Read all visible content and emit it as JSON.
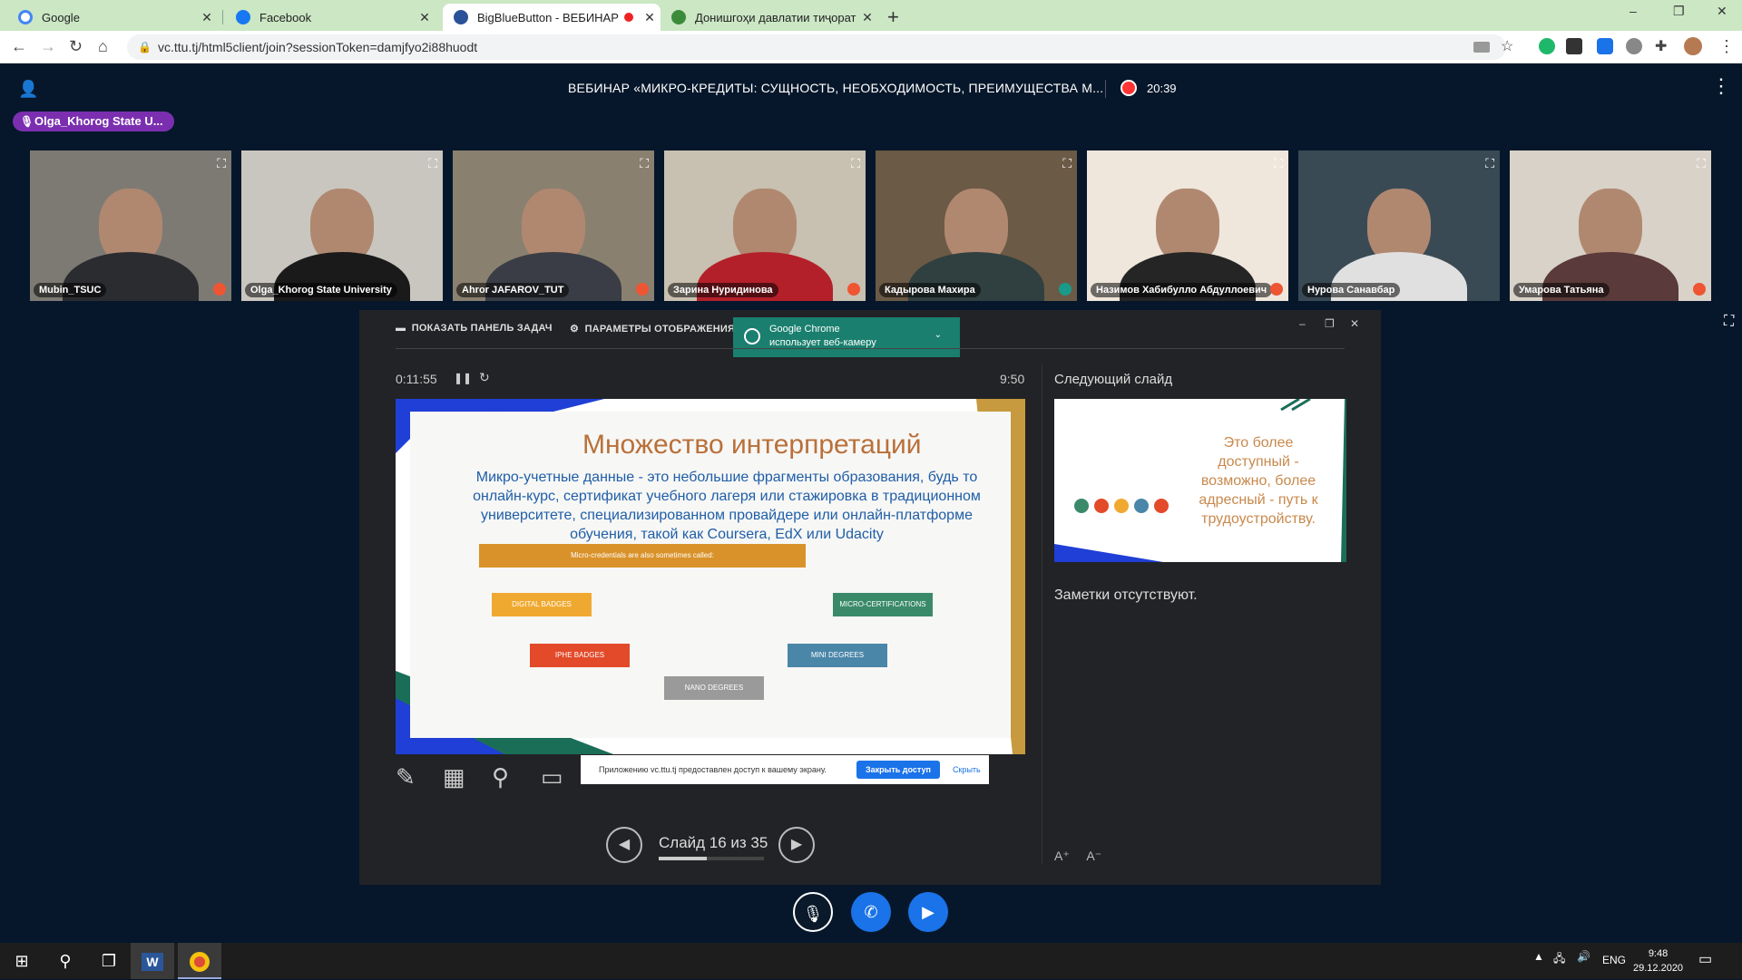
{
  "browser": {
    "tabs": [
      {
        "title": "Google",
        "favicon_color": "#4285f4"
      },
      {
        "title": "Facebook",
        "favicon_color": "#1877f2"
      },
      {
        "title": "BigBlueButton - ВЕБИНАР",
        "favicon_color": "#2a5298"
      },
      {
        "title": "Донишгоҳи давлатии тиҷорати",
        "favicon_color": "#3b8b3b"
      }
    ],
    "url": "vc.ttu.tj/html5client/join?sessionToken=damjfyo2i88huodt",
    "new_tab": "+",
    "window_controls": [
      "–",
      "❐",
      "✕"
    ]
  },
  "meeting": {
    "title": "ВЕБИНАР «МИКРО-КРЕДИТЫ: СУЩНОСТЬ, НЕОБХОДИМОСТЬ, ПРЕИМУЩЕСТВА М...",
    "record_time": "20:39",
    "talking_user": "Olga_Khorog State U..."
  },
  "videos": [
    {
      "name": "Mubin_TSUC",
      "bg": "#7d7a74",
      "shirt": "#2a2c30"
    },
    {
      "name": "Olga_Khorog State University",
      "bg": "#c9c6bf",
      "shirt": "#1a1a1a"
    },
    {
      "name": "Ahror JAFAROV_TUT",
      "bg": "#8a8070",
      "shirt": "#3a3d45"
    },
    {
      "name": "Зарина Нуридинова",
      "bg": "#c8c0b0",
      "shirt": "#b4202a"
    },
    {
      "name": "Кадырова Махира",
      "bg": "#6b5a45",
      "shirt": "#304040"
    },
    {
      "name": "Назимов Хабибулло Абдуллоевич",
      "bg": "#efe6dc",
      "shirt": "#252525"
    },
    {
      "name": "Нурова Санавбар",
      "bg": "#3a4a55",
      "shirt": "#e0e0e0"
    },
    {
      "name": "Умарова Татьяна",
      "bg": "#d9d2c8",
      "shirt": "#5a3a3a"
    }
  ],
  "presenter": {
    "show_taskbar": "ПОКАЗАТЬ ПАНЕЛЬ ЗАДАЧ",
    "display_settings": "ПАРАМЕТРЫ ОТОБРАЖЕНИЯ ▾",
    "notification_title": "Google Chrome",
    "notification_text": "использует веб-камеру",
    "elapsed": "0:11:55",
    "clock": "9:50",
    "slide_title": "Множество интерпретаций",
    "slide_text": "Микро-учетные данные - это небольшие фрагменты образования, будь то онлайн-курс, сертификат учебного лагеря или стажировка в традиционном университете, специализированном провайдере или онлайн-платформе обучения, такой как Coursera, EdX или Udacity",
    "slide_box_top": "Micro-credentials are also sometimes called:",
    "slide_labels": [
      "DIGITAL BADGES",
      "MICRO-CERTIFICATIONS",
      "IPHE BADGES",
      "MINI DEGREES",
      "NANO DEGREES"
    ],
    "next_label": "Следующий слайд",
    "next_text": "Это более доступный - возможно, более адресный - путь к трудоустройству.",
    "notes": "Заметки отсутствуют.",
    "share_text": "Приложению vc.ttu.tj предоставлен доступ к вашему экрану.",
    "share_stop": "Закрыть доступ",
    "share_hide": "Скрыть",
    "slide_counter": "Слайд 16 из 35",
    "progress": 0.457
  },
  "taskbar": {
    "lang": "ENG",
    "time": "9:48",
    "date": "29.12.2020"
  },
  "colors": {
    "accent": "#1a73e8",
    "bg": "#06172b",
    "talking": "#7b2fb0",
    "notification": "#1a7f6e"
  }
}
